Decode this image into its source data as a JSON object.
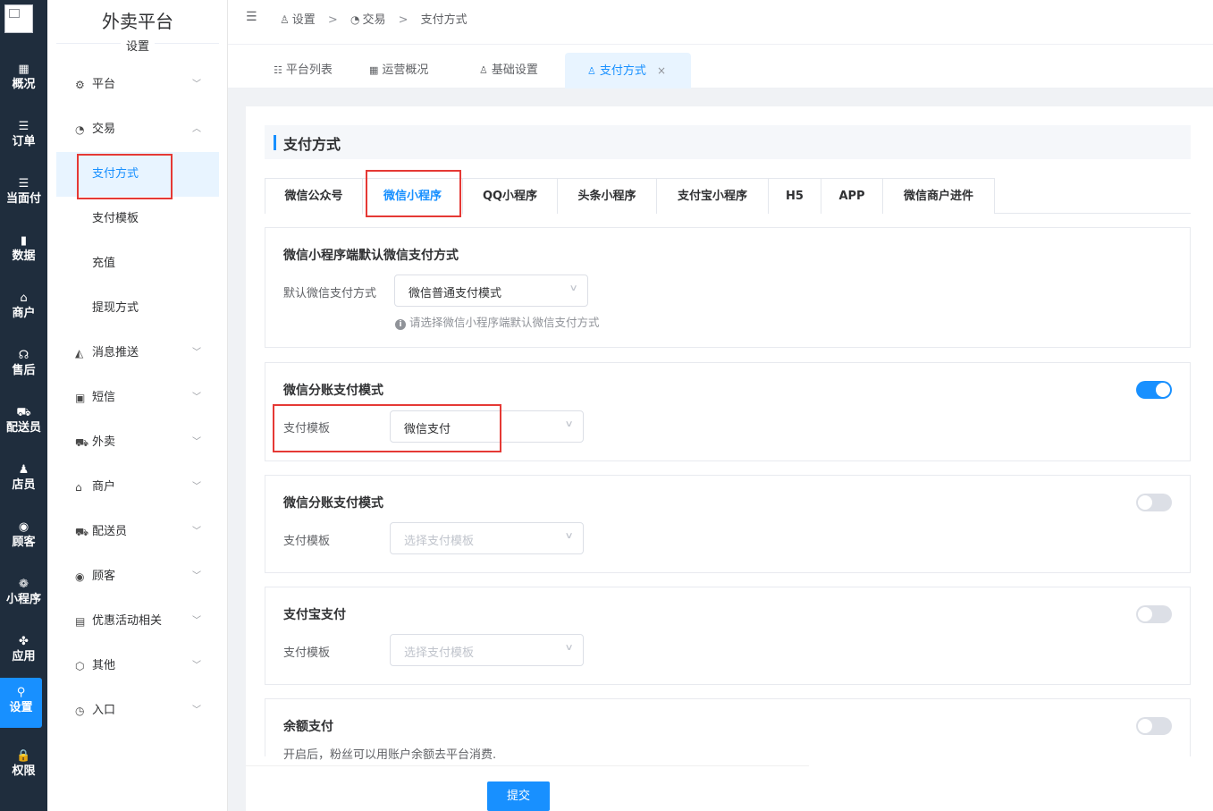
{
  "app": {
    "brand": "外卖平台",
    "section": "设置"
  },
  "rail": [
    {
      "icon": "grid-icon",
      "glyph": "▦",
      "label": "概况"
    },
    {
      "icon": "list-icon",
      "glyph": "☰",
      "label": "订单"
    },
    {
      "icon": "list-icon",
      "glyph": "☰",
      "label": "当面付"
    },
    {
      "icon": "bar-chart-icon",
      "glyph": "▮",
      "label": "数据"
    },
    {
      "icon": "store-icon",
      "glyph": "⌂",
      "label": "商户"
    },
    {
      "icon": "headset-icon",
      "glyph": "☊",
      "label": "售后"
    },
    {
      "icon": "scooter-icon",
      "glyph": "⛟",
      "label": "配送员"
    },
    {
      "icon": "user-icon",
      "glyph": "♟",
      "label": "店员"
    },
    {
      "icon": "customer-icon",
      "glyph": "◉",
      "label": "顾客"
    },
    {
      "icon": "wechat-icon",
      "glyph": "❁",
      "label": "小程序"
    },
    {
      "icon": "apps-icon",
      "glyph": "✤",
      "label": "应用"
    },
    {
      "icon": "settings-user-icon",
      "glyph": "⚲",
      "label": "设置"
    },
    {
      "icon": "lock-icon",
      "glyph": "🔒",
      "label": "权限"
    }
  ],
  "menu": {
    "platform": "平台",
    "trade": "交易",
    "trade_sub": [
      "支付方式",
      "支付模板",
      "充值",
      "提现方式"
    ],
    "items": [
      "消息推送",
      "短信",
      "外卖",
      "商户",
      "配送员",
      "顾客",
      "优惠活动相关",
      "其他",
      "入口"
    ]
  },
  "breadcrumb": [
    "设置",
    "交易",
    "支付方式"
  ],
  "tabs": [
    "平台列表",
    "运营概况",
    "基础设置",
    "支付方式"
  ],
  "page": {
    "title": "支付方式",
    "pay_tabs": [
      "微信公众号",
      "微信小程序",
      "QQ小程序",
      "头条小程序",
      "支付宝小程序",
      "H5",
      "APP",
      "微信商户进件"
    ],
    "active_pay_tab": "微信小程序",
    "sections": {
      "default": {
        "title": "微信小程序端默认微信支付方式",
        "label": "默认微信支付方式",
        "value": "微信普通支付模式",
        "hint": "请选择微信小程序端默认微信支付方式"
      },
      "split1": {
        "title": "微信分账支付模式",
        "label": "支付模板",
        "value": "微信支付",
        "enabled": true
      },
      "split2": {
        "title": "微信分账支付模式",
        "label": "支付模板",
        "placeholder": "选择支付模板",
        "enabled": false
      },
      "alipay": {
        "title": "支付宝支付",
        "label": "支付模板",
        "placeholder": "选择支付模板",
        "enabled": false
      },
      "balance": {
        "title": "余额支付",
        "desc": "开启后，粉丝可以用账户余额去平台消费.",
        "enabled": false
      }
    },
    "submit": "提交"
  },
  "colors": {
    "accent": "#1890ff",
    "rail_bg": "#1f2d3d",
    "highlight": "#e53935"
  }
}
